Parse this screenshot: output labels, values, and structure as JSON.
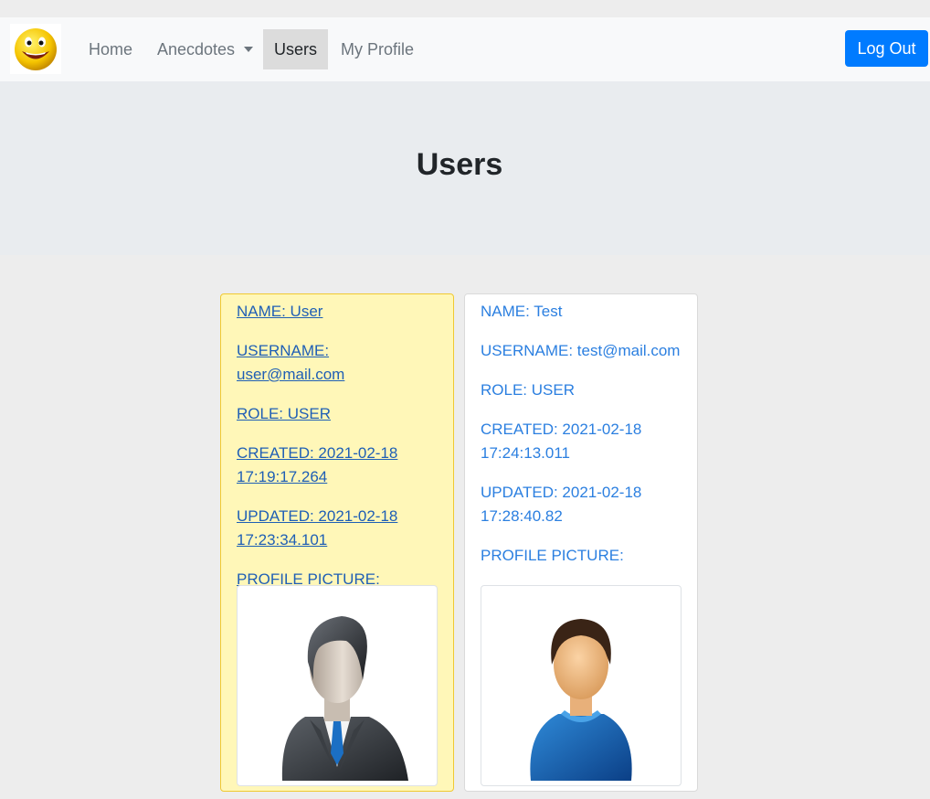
{
  "nav": {
    "logo_icon": "smiley-face-icon",
    "home": "Home",
    "anecdotes": "Anecdotes",
    "users": "Users",
    "my_profile": "My Profile",
    "logout": "Log Out"
  },
  "page": {
    "title": "Users"
  },
  "users": [
    {
      "name": "NAME: User",
      "username": "USERNAME: user@mail.com",
      "role": "ROLE: USER",
      "created": "CREATED: 2021-02-18 17:19:17.264",
      "updated": "UPDATED: 2021-02-18 17:23:34.101",
      "picture_label": "PROFILE PICTURE:",
      "picture_icon": "businessman-avatar-icon"
    },
    {
      "name": "NAME: Test",
      "username": "USERNAME: test@mail.com",
      "role": "ROLE: USER",
      "created": "CREATED: 2021-02-18 17:24:13.011",
      "updated": "UPDATED: 2021-02-18 17:28:40.82",
      "picture_label": "PROFILE PICTURE:",
      "picture_icon": "person-avatar-icon"
    }
  ],
  "colors": {
    "primary": "#007bff",
    "highlight_card": "#fff7b8",
    "link": "#2b7fe0"
  }
}
